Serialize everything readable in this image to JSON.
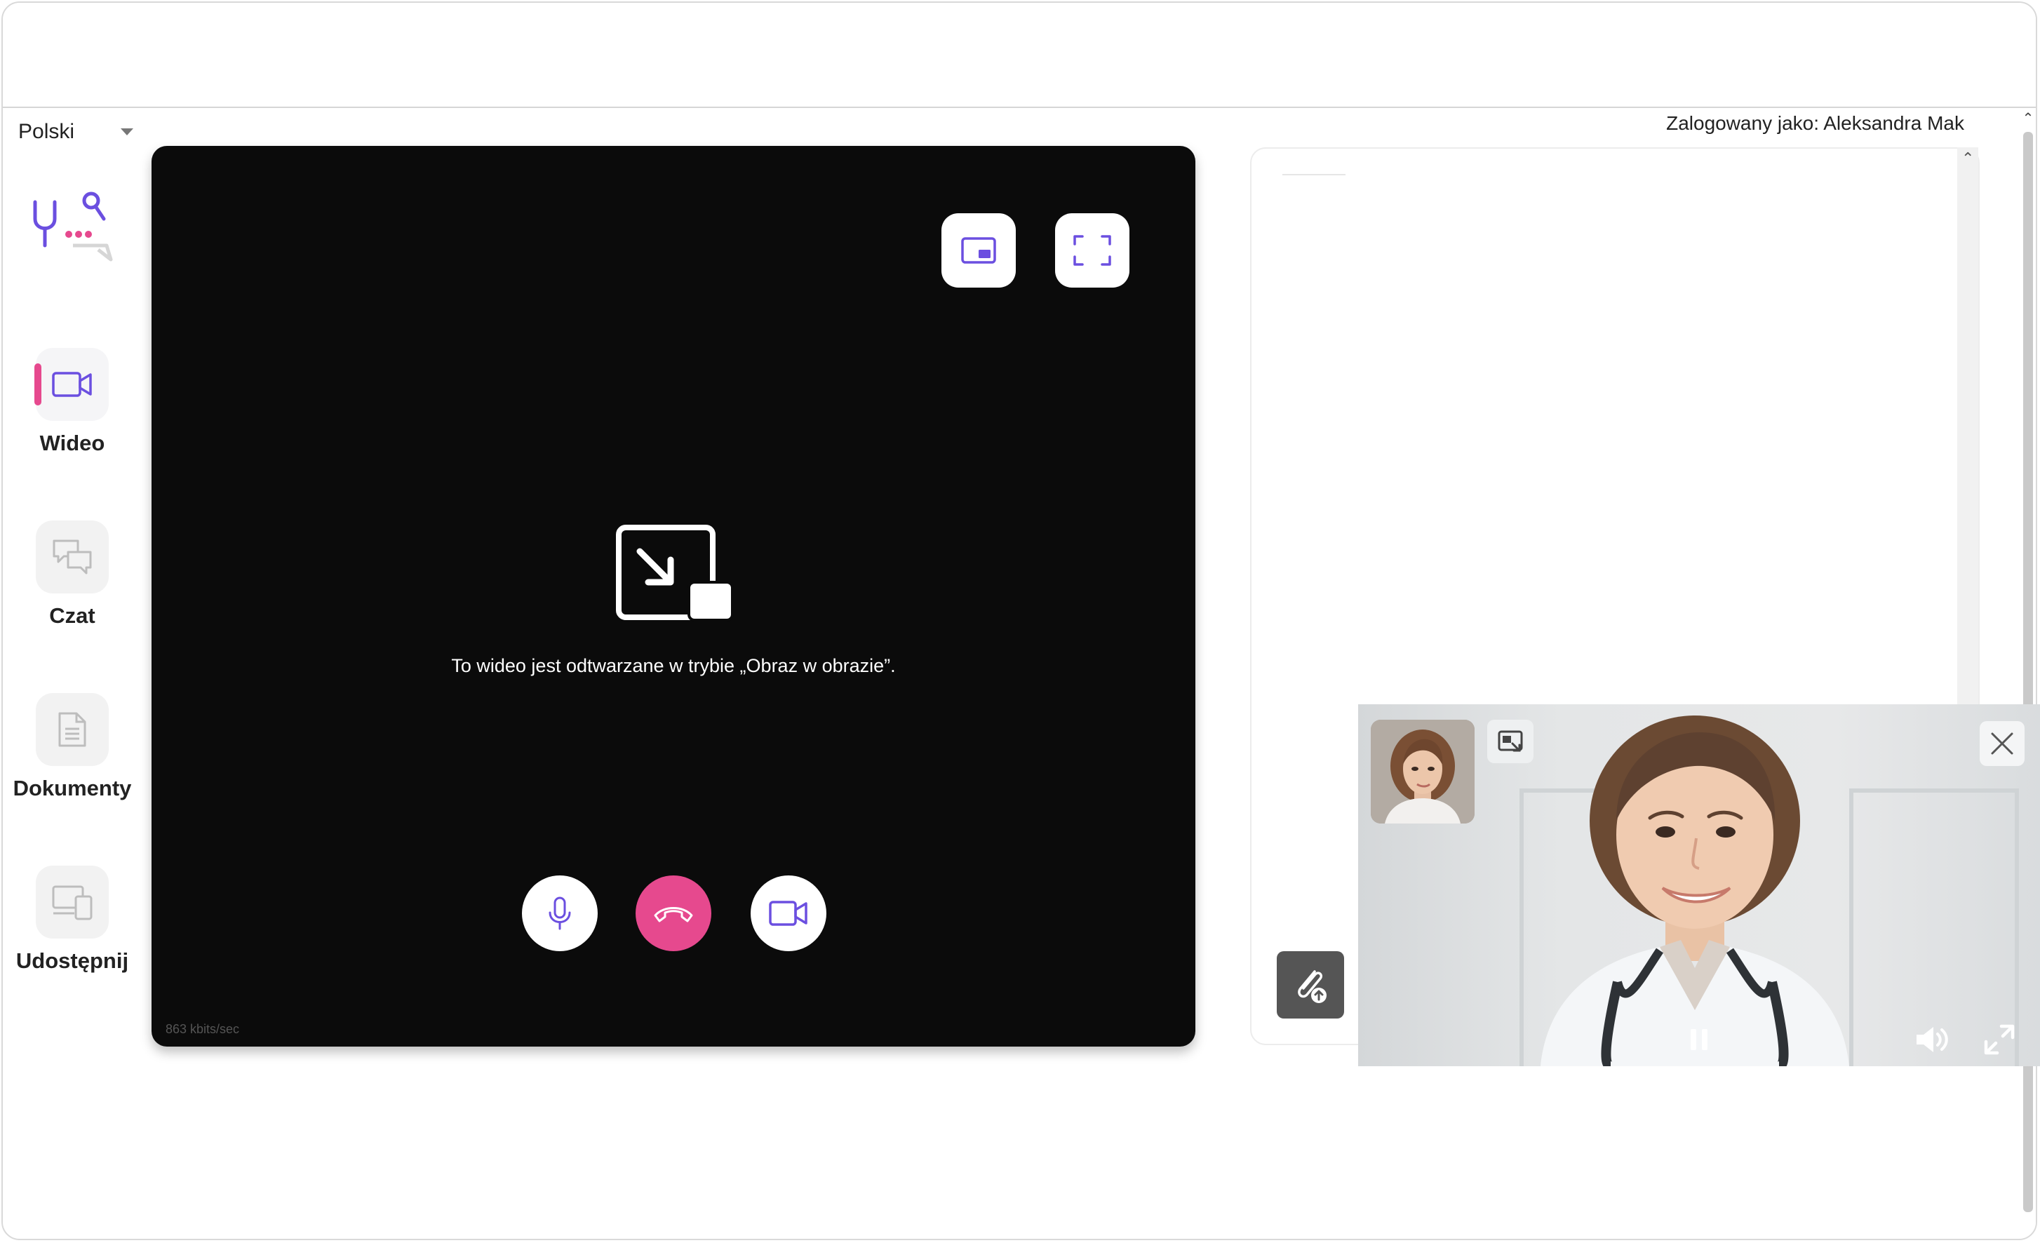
{
  "language": {
    "selected": "Polski"
  },
  "header": {
    "logged_in_as": "Zalogowany jako: Aleksandra Mak"
  },
  "sidebar": {
    "items": [
      {
        "label": "Wideo",
        "icon": "video-camera-icon",
        "active": true
      },
      {
        "label": "Czat",
        "icon": "chat-bubbles-icon",
        "active": false
      },
      {
        "label": "Dokumenty",
        "icon": "document-icon",
        "active": false
      },
      {
        "label": "Udostępnij",
        "icon": "share-screen-icon",
        "active": false
      }
    ]
  },
  "video": {
    "pip_message": "To wideo jest odtwarzane w trybie „Obraz w obrazie”.",
    "bitrate": "863 kbits/sec",
    "buttons": {
      "pip": "picture-in-picture-icon",
      "fullscreen": "fullscreen-icon",
      "mic": "microphone-icon",
      "hangup": "hang-up-icon",
      "camera": "video-camera-icon"
    }
  },
  "chat": {
    "attach_icon": "attach-upload-icon"
  },
  "pip_window": {
    "controls": [
      "back-to-tab-icon",
      "close-icon",
      "pause-icon",
      "volume-icon",
      "expand-icon"
    ]
  },
  "colors": {
    "accent": "#e6498e",
    "icon_purple": "#6b4fe0",
    "video_bg": "#0b0b0b"
  }
}
